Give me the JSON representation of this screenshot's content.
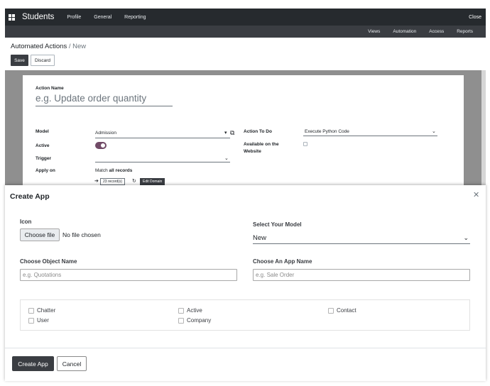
{
  "navbar": {
    "brand": "Students",
    "items": [
      "Profile",
      "General",
      "Reporting"
    ],
    "close": "Close"
  },
  "subnav": {
    "items": [
      "Views",
      "Automation",
      "Access",
      "Reports"
    ]
  },
  "breadcrumb": {
    "parent": "Automated Actions",
    "separator": "/",
    "current": "New"
  },
  "control_panel": {
    "save": "Save",
    "discard": "Discard"
  },
  "form": {
    "action_name_label": "Action Name",
    "action_name_placeholder": "e.g. Update order quantity",
    "model_label": "Model",
    "model_value": "Admission",
    "active_label": "Active",
    "trigger_label": "Trigger",
    "apply_on_label": "Apply on",
    "apply_on_text": "Match",
    "apply_on_bold": "all records",
    "records_btn": "23 record(s)",
    "edit_domain_btn": "Edit Domain",
    "action_to_do_label": "Action To Do",
    "action_to_do_value": "Execute Python Code",
    "available_label_1": "Available on the",
    "available_label_2": "Website"
  },
  "modal": {
    "title": "Create App",
    "icon_label": "Icon",
    "choose_file": "Choose file",
    "no_file": "No file chosen",
    "model_label": "Select Your Model",
    "model_value": "New",
    "object_label": "Choose Object Name",
    "object_placeholder": "e.g. Quotations",
    "app_label": "Choose An App Name",
    "app_placeholder": "e.g. Sale Order",
    "checkboxes": {
      "chatter": "Chatter",
      "user": "User",
      "active": "Active",
      "company": "Company",
      "contact": "Contact"
    },
    "create_button": "Create App",
    "cancel_button": "Cancel"
  },
  "colors": {
    "navbar": "#262a2e",
    "subnav": "#3a3d42",
    "accent_toggle": "#714b67",
    "primary_button": "#3a3d42"
  }
}
